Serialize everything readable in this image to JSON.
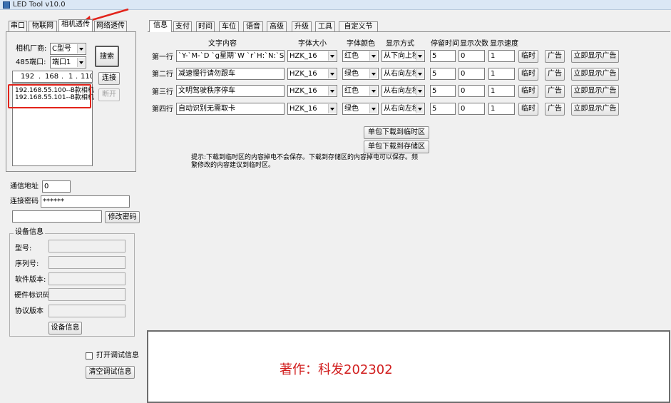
{
  "window": {
    "title": "LED Tool v10.0"
  },
  "left_tabs": [
    "串口",
    "物联网",
    "相机透传",
    "网络透传"
  ],
  "camera": {
    "vendor_label": "相机厂商:",
    "vendor_value": "C型号",
    "port_label": "485端口:",
    "port_value": "端口1",
    "search_label": "搜索",
    "ip_parts": [
      "192",
      "168",
      "1",
      "110"
    ],
    "connect_label": "连接",
    "disconnect_label": "断开",
    "devices": [
      "192.168.55.100--B款相机",
      "192.168.55.101--B款相机"
    ]
  },
  "comm": {
    "address_label": "通信地址",
    "address_value": "0",
    "password_label": "连接密码",
    "password_value": "******",
    "new_password_value": "",
    "change_password_label": "修改密码"
  },
  "device_info": {
    "group_title": "设备信息",
    "fields": [
      {
        "label": "型号:",
        "value": ""
      },
      {
        "label": "序列号:",
        "value": ""
      },
      {
        "label": "软件版本:",
        "value": ""
      },
      {
        "label": "硬件标识码",
        "value": ""
      },
      {
        "label": "协议版本",
        "value": ""
      }
    ],
    "button_label": "设备信息"
  },
  "debug": {
    "open_label": "打开调试信息",
    "clear_label": "清空调试信息"
  },
  "right_tabs": [
    "信息",
    "支付",
    "时间",
    "车位",
    "语音",
    "高级",
    "升级",
    "工具",
    "自定义节目"
  ],
  "table": {
    "headers": {
      "text": "文字内容",
      "font_size": "字体大小",
      "font_color": "字体颜色",
      "mode": "显示方式",
      "stay": "停留时间",
      "count": "显示次数",
      "speed": "显示速度"
    },
    "rows": [
      {
        "label": "第一行",
        "text": "`Y-`M-`D `g星期`W `r`H:`N:`S",
        "font": "HZK_16",
        "color": "红色",
        "mode": "从下向上移",
        "stay": "5",
        "count": "0",
        "speed": "1"
      },
      {
        "label": "第二行",
        "text": "减速慢行请勿跟车",
        "font": "HZK_16",
        "color": "绿色",
        "mode": "从右向左移",
        "stay": "5",
        "count": "0",
        "speed": "1"
      },
      {
        "label": "第三行",
        "text": "文明驾驶秩序停车",
        "font": "HZK_16",
        "color": "红色",
        "mode": "从右向左移",
        "stay": "5",
        "count": "0",
        "speed": "1"
      },
      {
        "label": "第四行",
        "text": "自动识别无需取卡",
        "font": "HZK_16",
        "color": "绿色",
        "mode": "从右向左移",
        "stay": "5",
        "count": "0",
        "speed": "1"
      }
    ],
    "temp_label": "临时",
    "ad_label": "广告",
    "show_ad_label": "立即显示广告"
  },
  "download": {
    "temp_label": "单包下载到临时区",
    "store_label": "单包下载到存储区",
    "hint": "提示:下载到临时区的内容掉电不会保存。下载到存储区的内容掉电可以保存。频繁修改的内容建议到临时区。"
  },
  "watermark": "著作：科发202302",
  "colors": {
    "annotation_red": "#e2231a",
    "watermark_red": "#d11f1f"
  }
}
